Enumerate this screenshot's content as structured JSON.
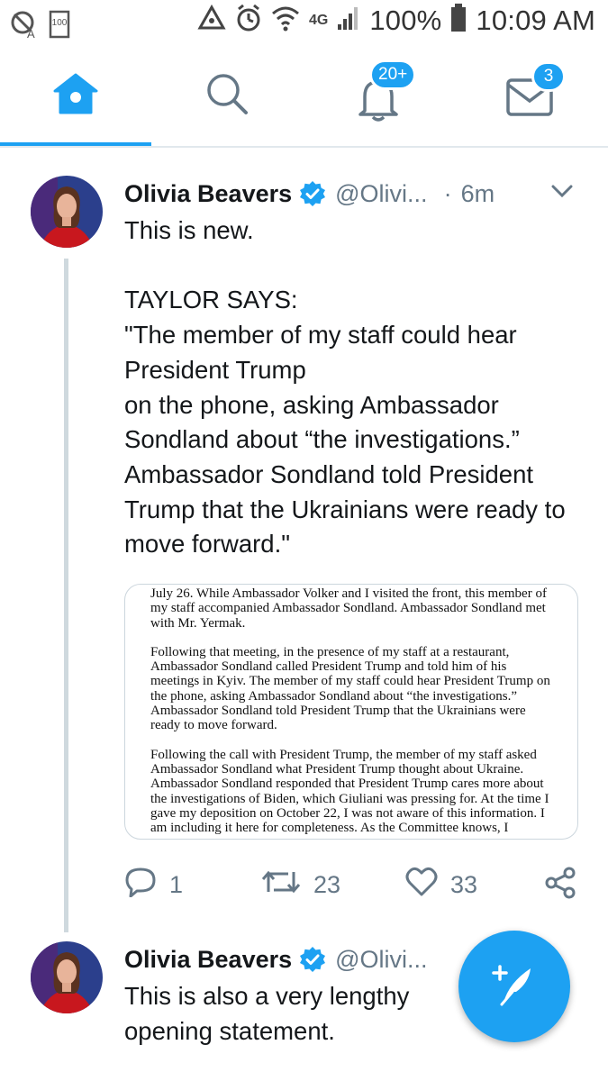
{
  "status_bar": {
    "battery_percent": "100%",
    "time": "10:09 AM",
    "small_badge": "100",
    "network": "4G"
  },
  "nav": {
    "tabs": [
      {
        "name": "home",
        "icon": "home-icon",
        "active": true
      },
      {
        "name": "search",
        "icon": "search-icon"
      },
      {
        "name": "notifications",
        "icon": "bell-icon",
        "badge": "20+"
      },
      {
        "name": "messages",
        "icon": "mail-icon",
        "badge": "3"
      }
    ],
    "accent": "#1da1f2"
  },
  "tweets": [
    {
      "name": "Olivia Beavers",
      "handle": "@Olivi...",
      "separator": "·",
      "time": "6m",
      "verified": true,
      "body": "This is new.\n\nTAYLOR SAYS:\n\"The member of my staff could hear President Trump\non the phone, asking Ambassador Sondland about “the investigations.” Ambassador Sondland told President Trump that the Ukrainians were ready to move forward.\"",
      "image_text": [
        "July 26. While Ambassador Volker and I visited the front, this member of my staff accompanied Ambassador Sondland. Ambassador Sondland met with Mr. Yermak.",
        "Following that meeting, in the presence of my staff at a restaurant, Ambassador Sondland called President Trump and told him of his meetings in Kyiv. The member of my staff could hear President Trump on the phone, asking Ambassador Sondland about “the investigations.” Ambassador Sondland told President Trump that the Ukrainians were ready to move forward.",
        "Following the call with President Trump, the member of my staff asked Ambassador Sondland what President Trump thought about Ukraine. Ambassador Sondland responded that President Trump cares more about the investigations of Biden, which Giuliani was pressing for. At the time I gave my deposition on October 22, I was not aware of this information. I am including it here for completeness. As the Committee knows, I"
      ],
      "replies": "1",
      "retweets": "23",
      "likes": "33"
    },
    {
      "name": "Olivia Beavers",
      "handle": "@Olivi...",
      "verified": true,
      "body": "This is also a very lengthy opening statement."
    }
  ]
}
